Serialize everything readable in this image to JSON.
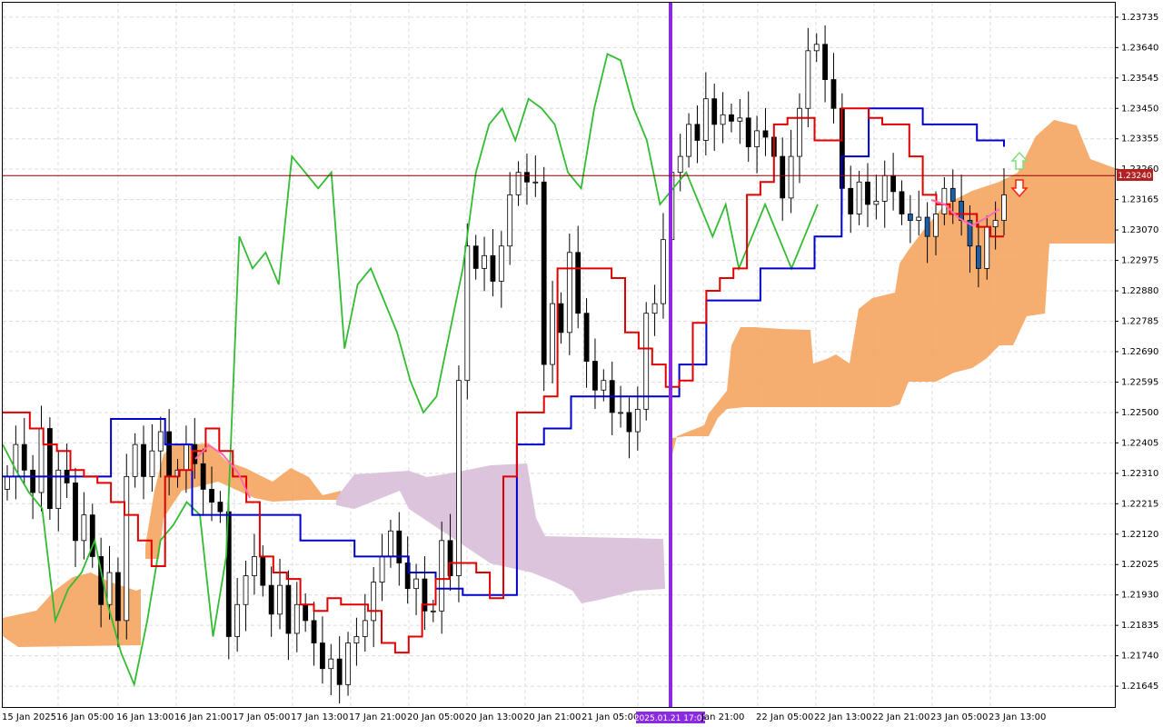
{
  "chart_data": {
    "type": "candlestick",
    "y_axis_labels": [
      "1.23735",
      "1.23640",
      "1.23545",
      "1.23450",
      "1.23355",
      "1.23260",
      "1.23165",
      "1.23070",
      "1.22975",
      "1.22880",
      "1.22785",
      "1.22690",
      "1.22595",
      "1.22500",
      "1.22405",
      "1.22310",
      "1.22215",
      "1.22120",
      "1.22025",
      "1.21930",
      "1.21835",
      "1.21740",
      "1.21645"
    ],
    "y_tick_values": [
      1.23735,
      1.2364,
      1.23545,
      1.2345,
      1.23355,
      1.2326,
      1.23165,
      1.2307,
      1.22975,
      1.2288,
      1.22785,
      1.2269,
      1.22595,
      1.225,
      1.22405,
      1.2231,
      1.22215,
      1.2212,
      1.22025,
      1.2193,
      1.21835,
      1.2174,
      1.21645
    ],
    "x_axis_labels": [
      "15 Jan 2025",
      "16 Jan 05:00",
      "16 Jan 13:00",
      "16 Jan 21:00",
      "17 Jan 05:00",
      "17 Jan 13:00",
      "17 Jan 21:00",
      "20 Jan 05:00",
      "20 Jan 13:00",
      "20 Jan 21:00",
      "21 Jan 05:00",
      "2025.01.21 17:00",
      "Jan 21:00",
      "22 Jan 05:00",
      "22 Jan 13:00",
      "22 Jan 21:00",
      "23 Jan 05:00",
      "23 Jan 13:00"
    ],
    "ylim": [
      1.2158,
      1.2378
    ],
    "current_price": 1.2324,
    "current_price_label": "1.23240",
    "highlight_time": "2025.01.21 17:00",
    "grid": true,
    "colors": {
      "bull_candle": "#ffffff",
      "bear_candle": "#000000",
      "blue_candle": "#1e5ea8",
      "tenkan": "#e00000",
      "kijun": "#0000cc",
      "chikou": "#33bb33",
      "cloud_bull": "#f4a460",
      "cloud_bear": "#d8bfd8",
      "vline": "#8a2be2",
      "price_line": "#8b0000",
      "pink": "#ff69b4",
      "arrow_up": "#7ee07e",
      "arrow_down": "#ff2000"
    },
    "series": [
      {
        "key": "close",
        "values": [
          1.223,
          1.224,
          1.2232,
          1.2225,
          1.2245,
          1.222,
          1.2232,
          1.2228,
          1.221,
          1.2218,
          1.2205,
          1.219,
          1.22,
          1.2185,
          1.223,
          1.224,
          1.223,
          1.2238,
          1.2244,
          1.223,
          1.2232,
          1.224,
          1.2234,
          1.2226,
          1.2222,
          1.2219,
          1.218,
          1.219,
          1.2199,
          1.2205,
          1.2196,
          1.2187,
          1.2196,
          1.2181,
          1.219,
          1.2185,
          1.2178,
          1.217,
          1.2173,
          1.2165,
          1.2178,
          1.218,
          1.2185,
          1.2197,
          1.2205,
          1.2213,
          1.2203,
          1.2195,
          1.2198,
          1.2188,
          1.2188,
          1.221,
          1.2199,
          1.226,
          1.2302,
          1.2295,
          1.2299,
          1.2291,
          1.2302,
          1.2318,
          1.2325,
          1.2322,
          1.2322,
          1.2265,
          1.2284,
          1.2275,
          1.23,
          1.2281,
          1.2266,
          1.2257,
          1.226,
          1.225,
          1.225,
          1.2244,
          1.2251,
          1.2281,
          1.2284,
          1.2304,
          1.2325,
          1.233,
          1.234,
          1.2335,
          1.2348,
          1.234,
          1.2343,
          1.2341,
          1.2342,
          1.2333,
          1.2338,
          1.2336,
          1.233,
          1.2317,
          1.233,
          1.2345,
          1.2363,
          1.2365,
          1.2354,
          1.2345,
          1.232,
          1.2312,
          1.2322,
          1.2315,
          1.2316,
          1.2324,
          1.2319,
          1.2312,
          1.231,
          1.2311,
          1.2305,
          1.2312,
          1.232,
          1.2316,
          1.231,
          1.2302,
          1.2295,
          1.2308,
          1.231,
          1.2318
        ]
      },
      {
        "key": "tenkan",
        "values": [
          1.225,
          1.225,
          1.2245,
          1.224,
          1.2238,
          1.2232,
          1.223,
          1.2228,
          1.2222,
          1.2218,
          1.221,
          1.2202,
          1.223,
          1.2232,
          1.2238,
          1.2245,
          1.2238,
          1.223,
          1.2222,
          1.2205,
          1.22,
          1.2198,
          1.219,
          1.2188,
          1.2192,
          1.219,
          1.219,
          1.2188,
          1.2178,
          1.2175,
          1.218,
          1.219,
          1.2198,
          1.2203,
          1.2203,
          1.22,
          1.2192,
          1.223,
          1.225,
          1.225,
          1.2255,
          1.2295,
          1.2295,
          1.2295,
          1.2295,
          1.2292,
          1.2275,
          1.227,
          1.2265,
          1.2258,
          1.226,
          1.2278,
          1.2288,
          1.2292,
          1.2295,
          1.2318,
          1.2322,
          1.234,
          1.2342,
          1.2342,
          1.2335,
          1.2335,
          1.2345,
          1.2345,
          1.2342,
          1.234,
          1.234,
          1.233,
          1.2318,
          1.2315,
          1.2312,
          1.2312,
          1.2308,
          1.2305,
          1.2305
        ]
      },
      {
        "key": "kijun",
        "values": [
          1.223,
          1.223,
          1.223,
          1.223,
          1.2248,
          1.2248,
          1.224,
          1.2218,
          1.2218,
          1.2218,
          1.2218,
          1.221,
          1.221,
          1.2205,
          1.2205,
          1.22,
          1.2195,
          1.2193,
          1.2193,
          1.224,
          1.2245,
          1.2255,
          1.2255,
          1.2255,
          1.2255,
          1.2265,
          1.2285,
          1.2285,
          1.2295,
          1.2295,
          1.2305,
          1.233,
          1.2345,
          1.2345,
          1.234,
          1.234,
          1.2335,
          1.2333
        ]
      },
      {
        "key": "chikou",
        "values": [
          1.224,
          1.2232,
          1.2225,
          1.222,
          1.2185,
          1.2195,
          1.22,
          1.221,
          1.219,
          1.2175,
          1.2165,
          1.2185,
          1.221,
          1.2215,
          1.2222,
          1.2218,
          1.218,
          1.2205,
          1.2305,
          1.2295,
          1.23,
          1.229,
          1.233,
          1.2325,
          1.232,
          1.2325,
          1.227,
          1.229,
          1.2295,
          1.2285,
          1.2275,
          1.226,
          1.225,
          1.2255,
          1.2275,
          1.2295,
          1.2325,
          1.234,
          1.2345,
          1.2335,
          1.2348,
          1.2345,
          1.234,
          1.2325,
          1.232,
          1.2345,
          1.2362,
          1.236,
          1.2345,
          1.2335,
          1.2315,
          1.232,
          1.2325,
          1.2315,
          1.2305,
          1.2315,
          1.2295,
          1.2305,
          1.2315,
          1.2305,
          1.2295,
          1.2305,
          1.2315
        ]
      }
    ]
  }
}
